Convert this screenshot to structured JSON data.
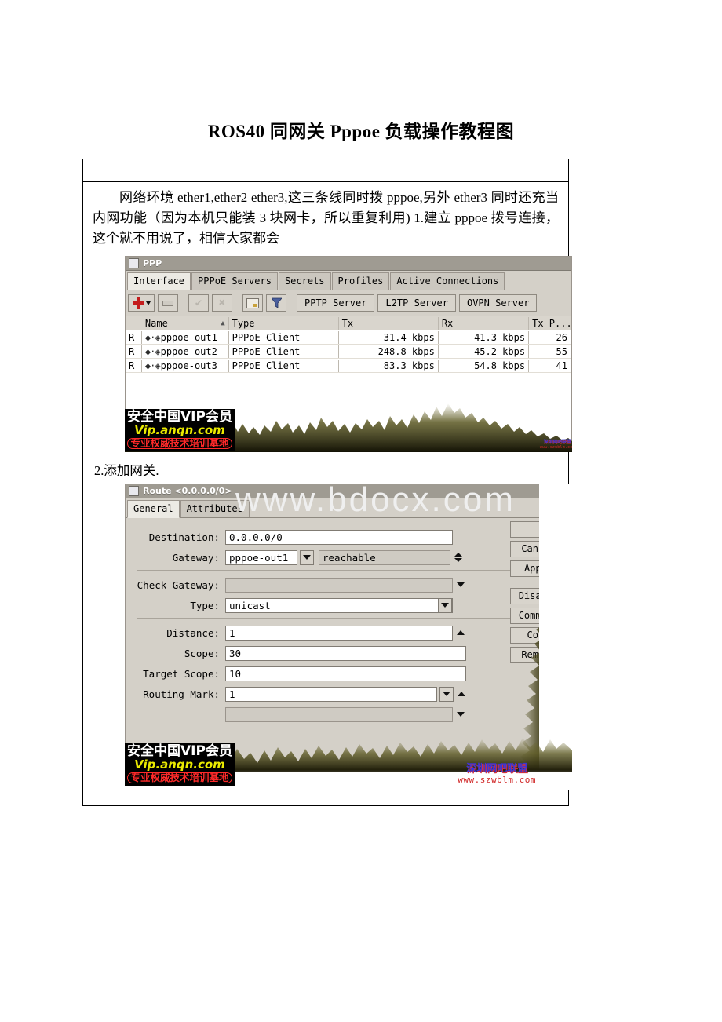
{
  "document": {
    "title": "ROS40 同网关 Pppoe 负载操作教程图",
    "paragraph_1": "网络环境 ether1,ether2 ether3,这三条线同时拨 pppoe,另外 ether3 同时还充当内网功能（因为本机只能装 3 块网卡，所以重复利用) 1.建立 pppoe 拨号连接，这个就不用说了，相信大家都会",
    "step_2_label": "2.添加网关.",
    "page_watermark": "www.bdocx.com"
  },
  "ppp_window": {
    "title": "PPP",
    "icon": "window-box-icon",
    "tabs": [
      {
        "label": "Interface",
        "active": true
      },
      {
        "label": "PPPoE Servers",
        "active": false
      },
      {
        "label": "Secrets",
        "active": false
      },
      {
        "label": "Profiles",
        "active": false
      },
      {
        "label": "Active Connections",
        "active": false
      }
    ],
    "toolbar": {
      "add": "add-plus-icon",
      "remove": "minus-icon",
      "enable": "check-icon",
      "disable": "cross-icon",
      "comment": "comment-box-icon",
      "filter": "filter-funnel-icon",
      "buttons": [
        {
          "label": "PPTP Server"
        },
        {
          "label": "L2TP Server"
        },
        {
          "label": "OVPN Server"
        }
      ]
    },
    "table": {
      "columns": [
        "",
        "Name",
        "Type",
        "Tx",
        "Rx",
        "Tx P..."
      ],
      "sort_indicator": "▲",
      "rows": [
        {
          "flag": "R",
          "name": "pppoe-out1",
          "type": "PPPoE Client",
          "tx": "31.4 kbps",
          "rx": "41.3 kbps",
          "txp": "26"
        },
        {
          "flag": "R",
          "name": "pppoe-out2",
          "type": "PPPoE Client",
          "tx": "248.8 kbps",
          "rx": "45.2 kbps",
          "txp": "55"
        },
        {
          "flag": "R",
          "name": "pppoe-out3",
          "type": "PPPoE Client",
          "tx": "83.3 kbps",
          "rx": "54.8 kbps",
          "txp": "41"
        }
      ]
    }
  },
  "route_window": {
    "title": "Route <0.0.0.0/0>",
    "icon": "window-box-icon",
    "tabs": [
      {
        "label": "General",
        "active": true
      },
      {
        "label": "Attributes",
        "active": false
      }
    ],
    "fields": [
      {
        "label": "Destination:",
        "value": "0.0.0.0/0",
        "control": "text"
      },
      {
        "label": "Gateway:",
        "value": "pppoe-out1",
        "secondary": "reachable",
        "control": "combo-plus-status"
      },
      {
        "label": "Check Gateway:",
        "value": "",
        "control": "dropdown-empty"
      },
      {
        "label": "Type:",
        "value": "unicast",
        "control": "dropdown"
      },
      {
        "label": "Distance:",
        "value": "1",
        "control": "text-up"
      },
      {
        "label": "Scope:",
        "value": "30",
        "control": "text"
      },
      {
        "label": "Target Scope:",
        "value": "10",
        "control": "text"
      },
      {
        "label": "Routing Mark:",
        "value": "1",
        "control": "dropdown-up"
      },
      {
        "label": "",
        "value": "",
        "control": "dropdown-empty"
      }
    ],
    "side_buttons": [
      {
        "label": ""
      },
      {
        "label": "Cancel"
      },
      {
        "label": "Apply"
      },
      {
        "label": "Disable"
      },
      {
        "label": "Comment"
      },
      {
        "label": "Copy"
      },
      {
        "label": "Remove"
      }
    ]
  },
  "watermarks": {
    "anqn": {
      "line1": "安全中国VIP会员",
      "line2": "Vip.anqn.com",
      "line3": "专业权威技术培训基地"
    },
    "szwblm": {
      "line1": "深圳网吧联盟",
      "line2": "www.szwblm.com"
    }
  },
  "colors": {
    "accent_red": "#c41d1d",
    "watermark_yellow": "#eaea00",
    "watermark_blue": "#3b35d6",
    "window_face": "#d4d0c8",
    "title_bar": "#9f9b92"
  }
}
